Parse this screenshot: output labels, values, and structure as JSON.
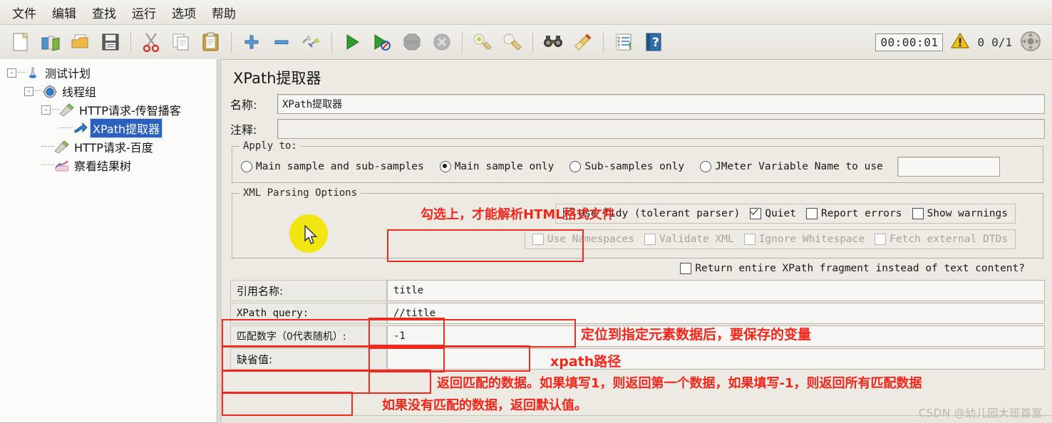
{
  "menu": {
    "items": [
      {
        "label": "文件",
        "name": "menu-file"
      },
      {
        "label": "编辑",
        "name": "menu-edit"
      },
      {
        "label": "查找",
        "name": "menu-search"
      },
      {
        "label": "运行",
        "name": "menu-run"
      },
      {
        "label": "选项",
        "name": "menu-options"
      },
      {
        "label": "帮助",
        "name": "menu-help"
      }
    ]
  },
  "toolbar": {
    "icons": [
      "new-icon",
      "templates-icon",
      "open-icon",
      "save-icon",
      "cut-icon",
      "copy-icon",
      "paste-icon",
      "add-icon",
      "remove-icon",
      "toggle-icon",
      "start-icon",
      "start-no-timers-icon",
      "stop-icon",
      "shutdown-icon",
      "clear-icon",
      "clear-all-icon",
      "search-icon",
      "reset-search-icon",
      "function-helper-icon",
      "help-icon"
    ],
    "timer": "00:00:01",
    "warning_count": "0",
    "thread_count": "0/1",
    "warning_icon": "warning-triangle-icon",
    "remote_icon": "remote-connect-icon"
  },
  "tree": {
    "nodes": [
      {
        "label": "测试计划",
        "icon": "test-plan-icon",
        "depth": 0,
        "toggle": "-",
        "selected": false
      },
      {
        "label": "线程组",
        "icon": "thread-group-icon",
        "depth": 1,
        "toggle": "-",
        "selected": false
      },
      {
        "label": "HTTP请求-传智播客",
        "icon": "http-request-icon",
        "depth": 2,
        "toggle": "-",
        "selected": false
      },
      {
        "label": "XPath提取器",
        "icon": "xpath-extractor-icon",
        "depth": 3,
        "toggle": "",
        "selected": true
      },
      {
        "label": "HTTP请求-百度",
        "icon": "http-request-icon",
        "depth": 2,
        "toggle": "",
        "selected": false
      },
      {
        "label": "察看结果树",
        "icon": "view-results-tree-icon",
        "depth": 2,
        "toggle": "",
        "selected": false
      }
    ]
  },
  "panel": {
    "title": "XPath提取器",
    "name_label": "名称:",
    "name_value": "XPath提取器",
    "comment_label": "注释:",
    "comment_value": "",
    "apply_to": {
      "group_title": "Apply to:",
      "options": [
        {
          "label": "Main sample and sub-samples",
          "selected": false
        },
        {
          "label": "Main sample only",
          "selected": true
        },
        {
          "label": "Sub-samples only",
          "selected": false
        },
        {
          "label": "JMeter Variable Name to use",
          "selected": false
        }
      ],
      "variable_value": ""
    },
    "xml_parsing": {
      "group_title": "XML Parsing Options",
      "primary_options": [
        {
          "label": "Use Tidy (tolerant parser)",
          "checked": true,
          "disabled": false
        },
        {
          "label": "Quiet",
          "checked": true,
          "disabled": false
        },
        {
          "label": "Report errors",
          "checked": false,
          "disabled": false
        },
        {
          "label": "Show warnings",
          "checked": false,
          "disabled": false
        }
      ],
      "secondary_options": [
        {
          "label": "Use Namespaces",
          "checked": false,
          "disabled": true
        },
        {
          "label": "Validate XML",
          "checked": false,
          "disabled": true
        },
        {
          "label": "Ignore Whitespace",
          "checked": false,
          "disabled": true
        },
        {
          "label": "Fetch external DTDs",
          "checked": false,
          "disabled": true
        }
      ]
    },
    "return_fragment": {
      "label": "Return entire XPath fragment instead of text content?",
      "checked": false
    },
    "fields": [
      {
        "label": "引用名称:",
        "value": "title",
        "mono": false
      },
      {
        "label": "XPath query:",
        "value": "//title",
        "mono": true
      },
      {
        "label": "匹配数字（0代表随机）:",
        "value": "-1",
        "mono": false
      },
      {
        "label": "缺省值:",
        "value": "",
        "mono": false
      }
    ]
  },
  "annotations": [
    {
      "text": "勾选上，才能解析HTML格式文件",
      "name": "annotation-use-tidy"
    },
    {
      "text": "定位到指定元素数据后，要保存的变量",
      "name": "annotation-reference-name"
    },
    {
      "text": "xpath路径",
      "name": "annotation-xpath-query"
    },
    {
      "text": "返回匹配的数据。如果填写1，则返回第一个数据，如果填写-1，则返回所有匹配数据",
      "name": "annotation-match-number"
    },
    {
      "text": "如果没有匹配的数据，返回默认值。",
      "name": "annotation-default-value"
    }
  ],
  "watermark": "CSDN @幼儿园大班首富."
}
